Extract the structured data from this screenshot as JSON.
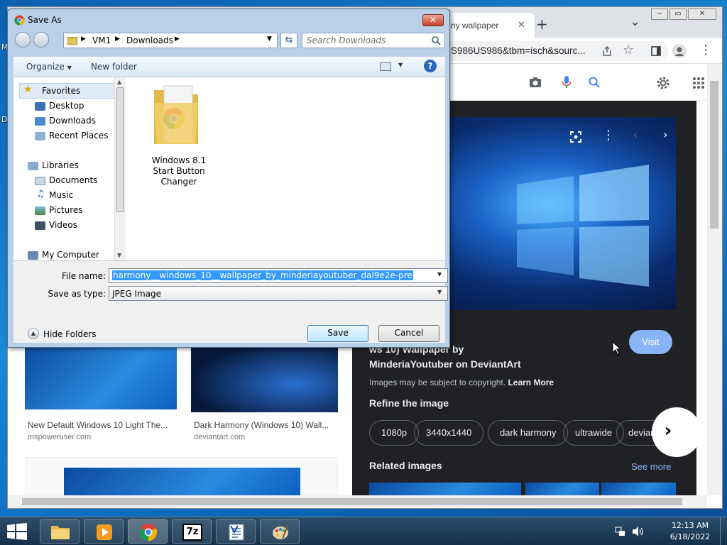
{
  "desktop": {
    "edge_labels": [
      "M",
      "D"
    ]
  },
  "chrome": {
    "tab_title": "ny wallpaper",
    "tab_close": "✕",
    "new_tab": "+",
    "tab_menu": "⌄",
    "url_fragment": "S986US986&tbm=isch&sourc...",
    "window_controls": [
      "─",
      "▭",
      "✕"
    ]
  },
  "results": [
    {
      "title": "New Default Windows 10 Light The...",
      "source": "mspoweruser.com"
    },
    {
      "title": "Dark Harmony (Windows 10) Wall...",
      "source": "deviantart.com"
    }
  ],
  "side_panel": {
    "title_line1": "ws 10) Wallpaper by",
    "title_line2": "MinderiaYoutuber on DeviantArt",
    "visit_label": "Visit",
    "copyright_text": "Images may be subject to copyright.",
    "learn_more": "Learn More",
    "refine_heading": "Refine the image",
    "chips": [
      "1080p",
      "3440x1440",
      "dark harmony",
      "ultrawide",
      "deviant"
    ],
    "related_heading": "Related images",
    "see_more": "See more"
  },
  "dialog": {
    "title": "Save As",
    "close_glyph": "✕",
    "breadcrumb": [
      "VM1",
      "Downloads"
    ],
    "search_placeholder": "Search Downloads",
    "organize_label": "Organize",
    "new_folder_label": "New folder",
    "help_glyph": "?",
    "nav": {
      "favorites": "Favorites",
      "favorites_items": [
        "Desktop",
        "Downloads",
        "Recent Places"
      ],
      "libraries": "Libraries",
      "libraries_items": [
        "Documents",
        "Music",
        "Pictures",
        "Videos"
      ],
      "computer": "My Computer"
    },
    "folder_name": [
      "Windows 8.1",
      "Start Button",
      "Changer"
    ],
    "file_name_label": "File name:",
    "file_name_value": "harmony__windows_10__wallpaper_by_minderiayoutuber_dal9e2e-pre",
    "save_type_label": "Save as type:",
    "save_type_value": "JPEG Image",
    "hide_folders": "Hide Folders",
    "save_label": "Save",
    "cancel_label": "Cancel"
  },
  "taskbar": {
    "time": "12:13 AM",
    "date": "6/18/2022",
    "apps": [
      "file-explorer",
      "media-player",
      "chrome",
      "7-zip",
      "wordpad",
      "paint"
    ]
  }
}
